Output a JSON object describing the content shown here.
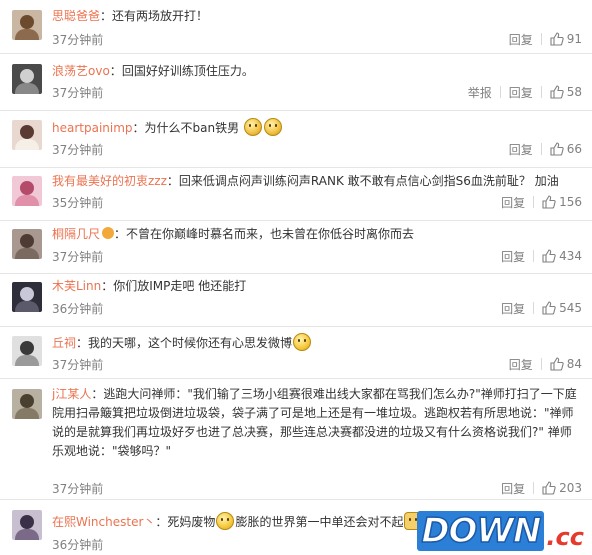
{
  "comments": [
    {
      "name": "思聪爸爸",
      "text": "还有两场放开打！",
      "time": "37分钟前",
      "actions": [
        "回复"
      ],
      "likes": "91",
      "avatar_bg": "#c9b7a3",
      "avatar_fg": "#6b4a2e"
    },
    {
      "name": "浪荡艺ovo",
      "text": "回国好好训练顶住压力。",
      "time": "37分钟前",
      "actions": [
        "举报",
        "回复"
      ],
      "likes": "58",
      "avatar_bg": "#4a4a4a",
      "avatar_fg": "#d0d0d0"
    },
    {
      "name": "heartpainimp",
      "text": "为什么不ban铁男",
      "time": "37分钟前",
      "actions": [
        "回复"
      ],
      "likes": "66",
      "avatar_bg": "#e8d8d0",
      "avatar_fg": "#5b3a34",
      "emoji": [
        "sad-face-icon",
        "sad-face-icon"
      ]
    },
    {
      "name": "我有最美好的初衷zzz",
      "text": "回来低调点闷声训练闷声RANK 敢不敢有点信心剑指S6血洗前耻？ 加油",
      "time": "35分钟前",
      "actions": [
        "回复"
      ],
      "likes": "156",
      "avatar_bg": "#f0c8d6",
      "avatar_fg": "#b44b6a"
    },
    {
      "name": "桐隔几尺",
      "text": "不曾在你巅峰时慕名而来，也未曾在你低谷时离你而去",
      "time": "37分钟前",
      "actions": [
        "回复"
      ],
      "likes": "434",
      "avatar_bg": "#a89890",
      "avatar_fg": "#4e3c34",
      "badge": "vip-badge-icon"
    },
    {
      "name": "木芙Linn",
      "text": "你们放IMP走吧 他还能打",
      "time": "36分钟前",
      "actions": [
        "回复"
      ],
      "likes": "545",
      "avatar_bg": "#2e2e3a",
      "avatar_fg": "#c8c8d8"
    },
    {
      "name": "丘祠",
      "text": "我的天哪，这个时候你还有心思发微博",
      "time": "37分钟前",
      "actions": [
        "回复"
      ],
      "likes": "84",
      "avatar_bg": "#e0e0e0",
      "avatar_fg": "#3a3a3a",
      "emoji_after": [
        "smile-face-icon"
      ]
    },
    {
      "name": "j江某人",
      "text": "逃跑大问禅师：\"我们输了三场小组赛很难出线大家都在骂我们怎么办?\"禅师打扫了一下庭院用扫帚簸箕把垃圾倒进垃圾袋，袋子满了可是地上还是有一堆垃圾。逃跑权若有所思地说：\"禅师说的是就算我们再垃圾好歹也进了总决赛，那些连总决赛都没进的垃圾又有什么资格说我们?\" 禅师乐观地说：\"袋够吗？\"",
      "time": "37分钟前",
      "actions": [
        "回复"
      ],
      "likes": "203",
      "avatar_bg": "#b8b0a0",
      "avatar_fg": "#4a4030"
    },
    {
      "name": "在熙Winchester丶",
      "text_a": "死妈废物",
      "text_b": "膨胀的世界第一中单还会对不起",
      "time": "36分钟前",
      "actions": [
        "回复"
      ],
      "likes": "",
      "avatar_bg": "#c8c0d0",
      "avatar_fg": "#3a3048"
    }
  ],
  "separator": "：",
  "watermark": {
    "main": "DOWN",
    "suffix": ".cc"
  },
  "colors": {
    "nickname": "#eb7350",
    "meta": "#808080",
    "border": "#e6e6e6"
  }
}
